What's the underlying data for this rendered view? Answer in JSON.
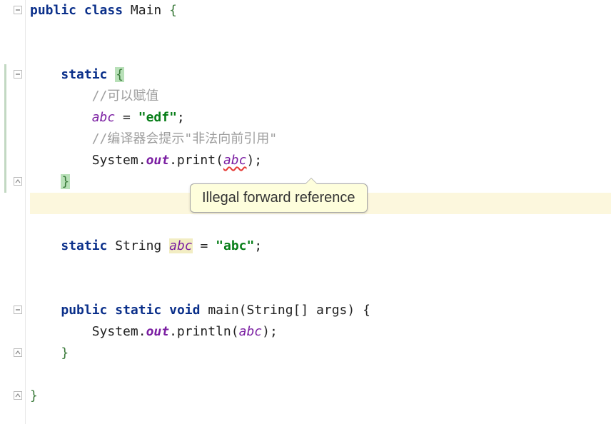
{
  "code": {
    "class_decl_public": "public",
    "class_decl_class": "class",
    "class_name": "Main",
    "open_brace": "{",
    "static_kw": "static",
    "comment_assign": "//可以赋值",
    "assign_var": "abc",
    "assign_eq": " = ",
    "assign_str": "\"edf\"",
    "semi": ";",
    "comment_fwd": "//编译器会提示\"非法向前引用\"",
    "sysout_system": "System.",
    "sysout_out": "out",
    "sysout_print": ".print(",
    "sysout_arg_err": "abc",
    "sysout_close": ");",
    "close_brace": "}",
    "field_static": "static",
    "field_type": "String",
    "field_name": "abc",
    "field_eq": " = ",
    "field_val": "\"abc\"",
    "main_public": "public",
    "main_static": "static",
    "main_void": "void",
    "main_name": "main",
    "main_params_open": "(String[] args) {",
    "main_println": ".println(",
    "main_arg": "abc",
    "main_close": ");",
    "class_close": "}"
  },
  "tooltip": {
    "text": "Illegal forward reference"
  },
  "gutter": {
    "fold_minus": "−",
    "fold_up": "▵"
  }
}
